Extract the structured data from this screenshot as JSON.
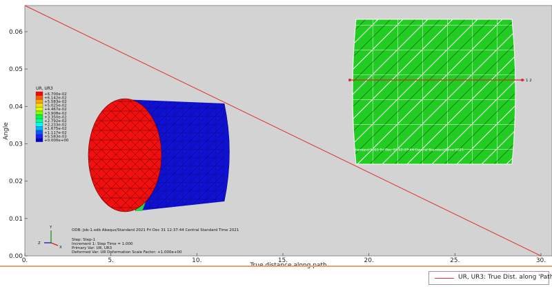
{
  "chart_data": {
    "type": "line",
    "xlabel": "True distance along path",
    "ylabel": "Angle",
    "xlim": [
      0,
      30
    ],
    "ylim": [
      0,
      0.067
    ],
    "x_ticks": [
      "0.",
      "5.",
      "10.",
      "15.",
      "20.",
      "25.",
      "30."
    ],
    "y_ticks": [
      "0.00",
      "0.01",
      "0.02",
      "0.03",
      "0.04",
      "0.05",
      "0.06"
    ],
    "series": [
      {
        "name": "UR, UR3: True Dist. along 'Path-1'",
        "color": "#e03030",
        "x": [
          0,
          30
        ],
        "y": [
          0.067,
          0.0
        ]
      }
    ],
    "legend": "bottom-right",
    "grid": false,
    "background": "#d3d3d3"
  },
  "overlay": {
    "colorbar": {
      "title": "UR, UR3",
      "labels": [
        "+6.700e-02",
        "+6.142e-02",
        "+5.583e-02",
        "+5.025e-02",
        "+4.467e-02",
        "+3.908e-02",
        "+3.350e-02",
        "+2.792e-02",
        "+2.233e-02",
        "+1.675e-02",
        "+1.117e-02",
        "+5.583e-03",
        "+0.000e+00"
      ],
      "colors": [
        "#ff0000",
        "#ff5a00",
        "#ffa500",
        "#ffd700",
        "#d9ff00",
        "#7fff00",
        "#00ff3c",
        "#00ff9c",
        "#00ffee",
        "#00b4ff",
        "#005aff",
        "#1a1aff",
        "#0000c8"
      ]
    },
    "info_lines": [
      "ODB: Job-1.odb    Abaqus/Standard 2021    Fri Dec 31 12:37:44 Central Standard Time 2021",
      "Step: Step-1",
      "Increment    1: Step Time =    1.000",
      "Primary Var: UR, UR3",
      "Deformed Var: UR   Deformation Scale Factor: +1.000e+00"
    ],
    "triad": {
      "y": "Y",
      "z": "Z",
      "x": "X"
    },
    "faint_text": "Standard 2021    Fri Dec 31 12:37:44 Central Standard Time 2021",
    "path_marker_label": "1 2"
  }
}
